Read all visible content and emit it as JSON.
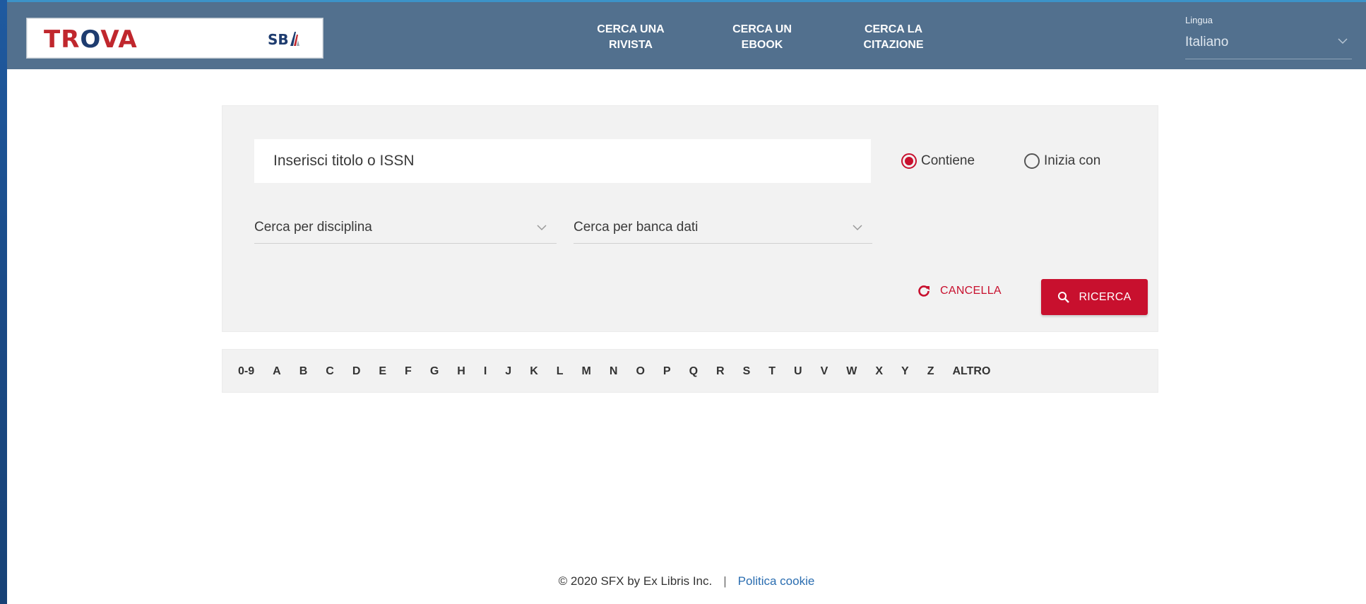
{
  "header": {
    "logo_text_1": "TR",
    "logo_text_o": "O",
    "logo_text_2": "VA",
    "partner_logo": "SB",
    "nav": [
      {
        "line1": "CERCA UNA",
        "line2": "RIVISTA"
      },
      {
        "line1": "CERCA UN",
        "line2": "EBOOK"
      },
      {
        "line1": "CERCA LA",
        "line2": "CITAZIONE"
      }
    ],
    "language": {
      "label": "Lingua",
      "value": "Italiano"
    }
  },
  "search": {
    "placeholder": "Inserisci titolo o ISSN",
    "radio_contains": "Contiene",
    "radio_starts_with": "Inizia con",
    "selected_mode": "Contiene",
    "discipline_select": "Cerca per disciplina",
    "database_select": "Cerca per banca dati",
    "cancel_label": "CANCELLA",
    "search_label": "RICERCA"
  },
  "alphabet": [
    "0-9",
    "A",
    "B",
    "C",
    "D",
    "E",
    "F",
    "G",
    "H",
    "I",
    "J",
    "K",
    "L",
    "M",
    "N",
    "O",
    "P",
    "Q",
    "R",
    "S",
    "T",
    "U",
    "V",
    "W",
    "X",
    "Y",
    "Z",
    "ALTRO"
  ],
  "footer": {
    "copyright": "© 2020 SFX by Ex Libris Inc.",
    "separator": "|",
    "cookie_link": "Politica cookie"
  },
  "colors": {
    "header_bg": "#52708e",
    "accent_red": "#c8102e",
    "panel_bg": "#f2f2f2",
    "link_blue": "#2a6db0"
  }
}
